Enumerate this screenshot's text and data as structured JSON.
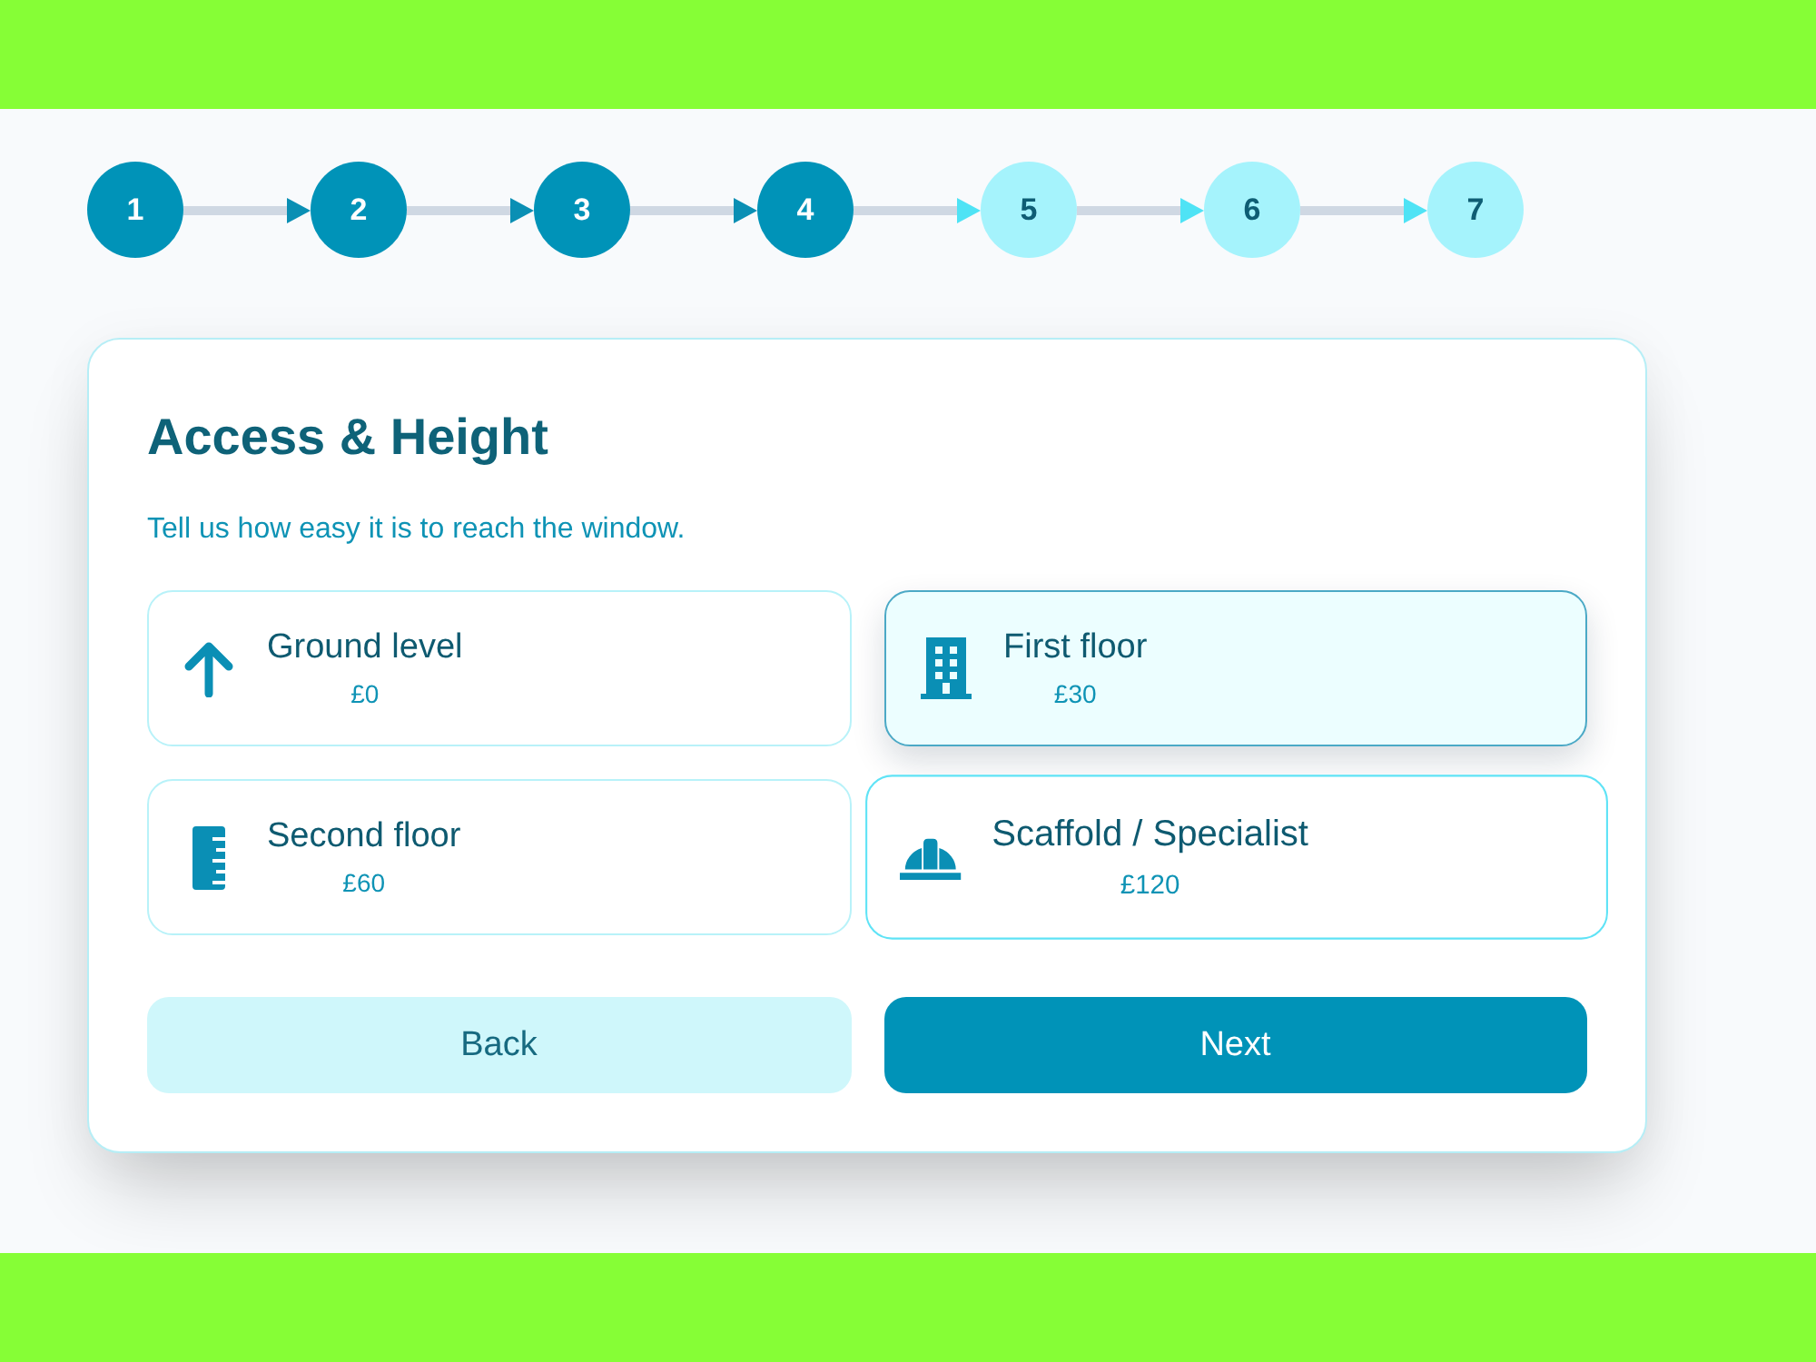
{
  "steps": [
    {
      "label": "1",
      "done": true
    },
    {
      "label": "2",
      "done": true
    },
    {
      "label": "3",
      "done": true
    },
    {
      "label": "4",
      "done": true
    },
    {
      "label": "5",
      "done": false
    },
    {
      "label": "6",
      "done": false
    },
    {
      "label": "7",
      "done": false
    }
  ],
  "panel": {
    "title": "Access & Height",
    "subtitle": "Tell us how easy it is to reach the window.",
    "options": [
      {
        "label": "Ground level",
        "price": "£0",
        "selected": false,
        "hovered": false
      },
      {
        "label": "First floor",
        "price": "£30",
        "selected": true,
        "hovered": false
      },
      {
        "label": "Second floor",
        "price": "£60",
        "selected": false,
        "hovered": false
      },
      {
        "label": "Scaffold / Specialist",
        "price": "£120",
        "selected": false,
        "hovered": true
      }
    ],
    "buttons": [
      {
        "label": "Back",
        "kind": "secondary"
      },
      {
        "label": "Next",
        "kind": "primary"
      }
    ]
  }
}
